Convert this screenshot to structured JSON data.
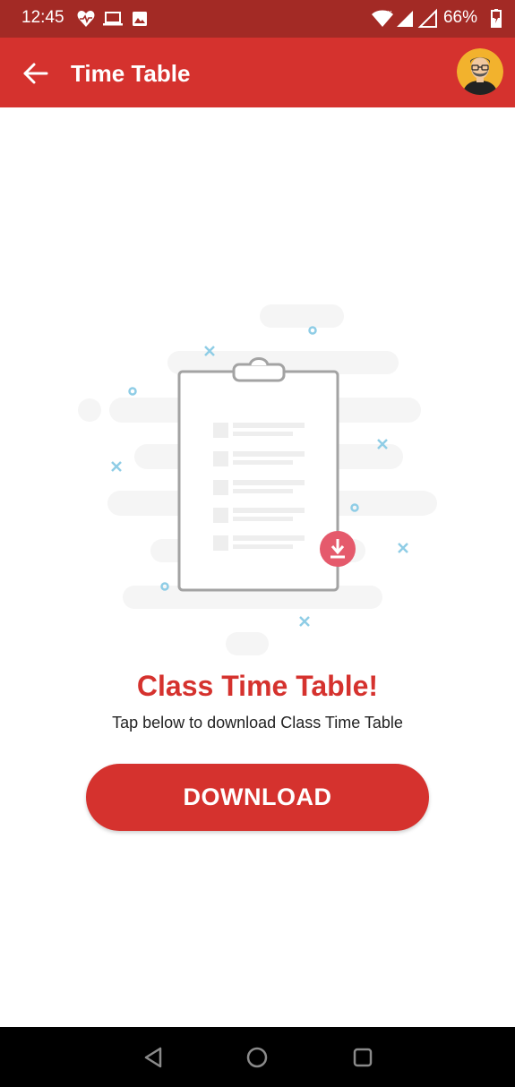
{
  "status_bar": {
    "time": "12:45",
    "battery": "66%",
    "icons": [
      "heart-pulse-icon",
      "laptop-icon",
      "image-icon",
      "wifi-icon",
      "signal-icon",
      "battery-charging-icon"
    ]
  },
  "app_bar": {
    "title": "Time Table",
    "color": "#d5322e",
    "back_icon": "arrow-left-icon"
  },
  "content": {
    "heading": "Class Time Table!",
    "subtitle": "Tap below to download Class Time Table",
    "button_label": "DOWNLOAD",
    "accent_color": "#d5322e",
    "illustration_icon": "clipboard-download-icon"
  },
  "nav_bar": {
    "icons": [
      "back-triangle-icon",
      "home-circle-icon",
      "recents-square-icon"
    ]
  }
}
